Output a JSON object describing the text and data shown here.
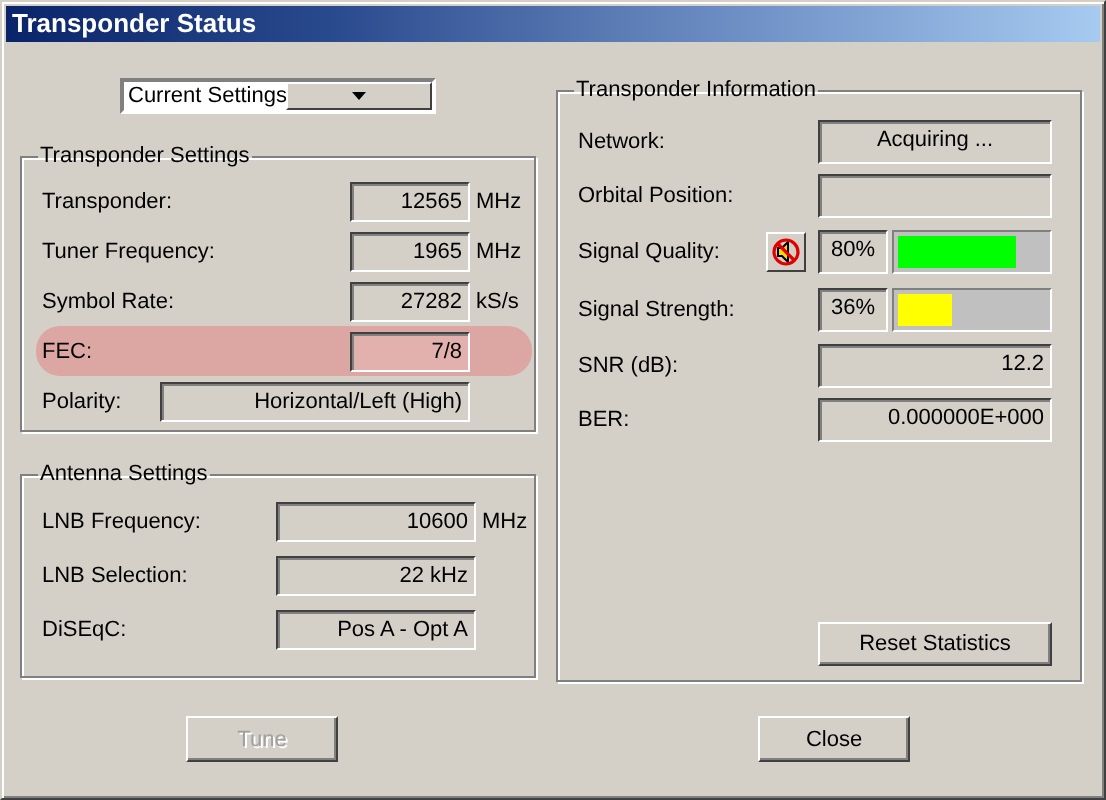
{
  "window": {
    "title": "Transponder Status"
  },
  "settings_dropdown": {
    "value": "Current Settings"
  },
  "transponder_settings": {
    "title": "Transponder Settings",
    "rows": [
      {
        "kind": "short",
        "label": "Transponder:",
        "value": "12565",
        "unit": "MHz",
        "highlighted": false
      },
      {
        "kind": "short",
        "label": "Tuner Frequency:",
        "value": "1965",
        "unit": "MHz",
        "highlighted": false
      },
      {
        "kind": "short",
        "label": "Symbol Rate:",
        "value": "27282",
        "unit": "kS/s",
        "highlighted": false
      },
      {
        "kind": "short",
        "label": "FEC:",
        "value": "7/8",
        "highlighted": true
      },
      {
        "kind": "wide",
        "label": "Polarity:",
        "value": "Horizontal/Left (High)",
        "highlighted": false
      }
    ]
  },
  "antenna_settings": {
    "title": "Antenna Settings",
    "rows": [
      {
        "label": "LNB Frequency:",
        "value": "10600",
        "unit": "MHz"
      },
      {
        "label": "LNB Selection:",
        "value": "22 kHz"
      },
      {
        "label": "DiSEqC:",
        "value": "Pos A - Opt A"
      }
    ]
  },
  "transponder_information": {
    "title": "Transponder Information",
    "rows": [
      {
        "kind": "text",
        "label": "Network:",
        "value": "Acquiring ..."
      },
      {
        "kind": "text",
        "label": "Orbital Position:"
      },
      {
        "kind": "meter",
        "label": "Signal Quality:",
        "reading": "80%",
        "level": 0.8,
        "color": "#00ff00",
        "sound_button": true
      },
      {
        "kind": "meter",
        "label": "Signal Strength:",
        "reading": "36%",
        "level": 0.36,
        "color": "#ffff00",
        "sound_button": false
      },
      {
        "kind": "number",
        "label": "SNR (dB):",
        "value": "12.2"
      },
      {
        "kind": "number",
        "label": "BER:",
        "value": "0.000000E+000"
      }
    ],
    "reset_button": "Reset Statistics"
  },
  "buttons": [
    {
      "label": "Tune",
      "disabled": true
    },
    {
      "label": "Close",
      "disabled": false
    }
  ]
}
